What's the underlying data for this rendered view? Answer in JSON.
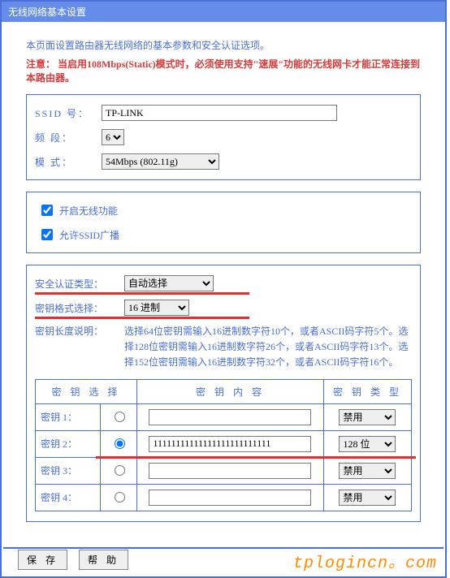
{
  "title": "无线网络基本设置",
  "intro": "本页面设置路由器无线网络的基本参数和安全认证选项。",
  "notice_label": "注意：",
  "notice_text": "当启用108Mbps(Static)模式时，必须使用支持\"速展\"功能的无线网卡才能正常连接到本路由器。",
  "basic": {
    "ssid_label": "SSID 号：",
    "ssid_value": "TP-LINK",
    "channel_label": "频 段：",
    "channel_value": "6",
    "mode_label": "模 式：",
    "mode_value": "54Mbps (802.11g)"
  },
  "switches": {
    "enable_wireless": "开启无线功能",
    "enable_broadcast": "允许SSID广播"
  },
  "security": {
    "auth_label": "安全认证类型：",
    "auth_value": "自动选择",
    "key_format_label": "密钥格式选择：",
    "key_format_value": "16 进制",
    "key_len_label": "密钥长度说明：",
    "key_len_desc": "选择64位密钥需输入16进制数字符10个，或者ASCII码字符5个。选择128位密钥需输入16进制数字符26个，或者ASCII码字符13个。选择152位密钥需输入16进制数字符32个，或者ASCII码字符16个。",
    "table": {
      "col_select": "密 钥 选 择",
      "col_content": "密 钥 内 容",
      "col_type": "密 钥 类 型",
      "rows": [
        {
          "label": "密钥 1：",
          "value": "",
          "type": "禁用",
          "selected": false
        },
        {
          "label": "密钥 2：",
          "value": "11111111111111111111111111",
          "type": "128 位",
          "selected": true
        },
        {
          "label": "密钥 3：",
          "value": "",
          "type": "禁用",
          "selected": false
        },
        {
          "label": "密钥 4：",
          "value": "",
          "type": "禁用",
          "selected": false
        }
      ]
    }
  },
  "buttons": {
    "save": "保 存",
    "help": "帮 助"
  },
  "watermark": "tplogincn。com"
}
